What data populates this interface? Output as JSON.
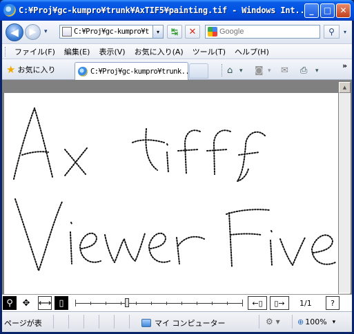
{
  "window": {
    "title": "C:¥Proj¥gc-kumpro¥trunk¥AxTIF5¥painting.tif - Windows Int...",
    "minimize_glyph": "_",
    "maximize_glyph": "□",
    "close_glyph": "✕"
  },
  "address_bar": {
    "url": "C:¥Proj¥gc-kumpro¥t",
    "search_placeholder": "Google",
    "back_glyph": "◀",
    "forward_glyph": "▶",
    "dropdown_glyph": "▾",
    "refresh_glyph": "↹",
    "stop_glyph": "✕",
    "search_glyph": "⚲"
  },
  "menu": {
    "items": [
      "ファイル(F)",
      "編集(E)",
      "表示(V)",
      "お気に入り(A)",
      "ツール(T)",
      "ヘルプ(H)"
    ]
  },
  "favorites_bar": {
    "favorites_label": "お気に入り",
    "star_glyph": "★",
    "tab_title": "C:¥Proj¥gc-kumpro¥trunk...",
    "home_glyph": "⌂",
    "feeds_glyph": "◙",
    "mail_glyph": "✉",
    "print_glyph": "⎙",
    "chevron_glyph": "»"
  },
  "viewer": {
    "image_text_line1": "Ax tiff",
    "image_text_line2": "ViewerFive",
    "up_arrow": "▲",
    "down_arrow": "▼",
    "left_arrow": "◀",
    "right_arrow": "▶",
    "zoom_tool_glyph": "⚲",
    "pan_tool_glyph": "✥",
    "fit_width_glyph": "⟷",
    "fit_page_glyph": "▯",
    "prev_page_label": "←▯",
    "next_page_label": "▯→",
    "page_indicator": "1/1",
    "help_label": "?",
    "zoom_slider_fraction": 0.31
  },
  "status_bar": {
    "status_text": "ページが表",
    "zone_text": "マイ コンピューター",
    "zoom_text": "100%",
    "zoom_glyph": "⊕",
    "protect_glyph": "⚙"
  }
}
